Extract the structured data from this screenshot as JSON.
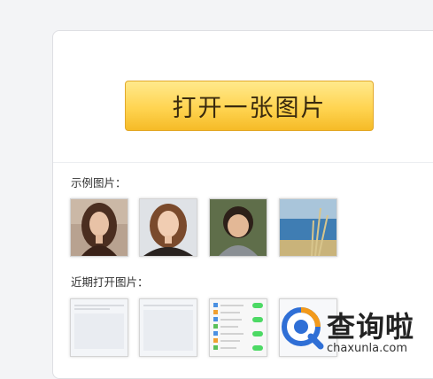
{
  "open_button": {
    "label": "打开一张图片"
  },
  "samples": {
    "label": "示例图片：",
    "items": [
      {
        "name": "portrait-woman-brown-hair"
      },
      {
        "name": "portrait-woman-smiling"
      },
      {
        "name": "portrait-child"
      },
      {
        "name": "sea-grass-landscape"
      }
    ]
  },
  "recent": {
    "label": "近期打开图片：",
    "items": [
      {
        "name": "recent-document-1"
      },
      {
        "name": "recent-document-2"
      },
      {
        "name": "recent-settings-screen"
      },
      {
        "name": "recent-blank"
      }
    ]
  },
  "watermark": {
    "title": "查询啦",
    "url": "chaxunla.com",
    "icon": "magnifier-logo-icon"
  },
  "colors": {
    "button_top": "#ffe98c",
    "button_bottom": "#f5bb27",
    "watermark_blue": "#2f6fd6",
    "watermark_orange": "#f39a1b"
  }
}
